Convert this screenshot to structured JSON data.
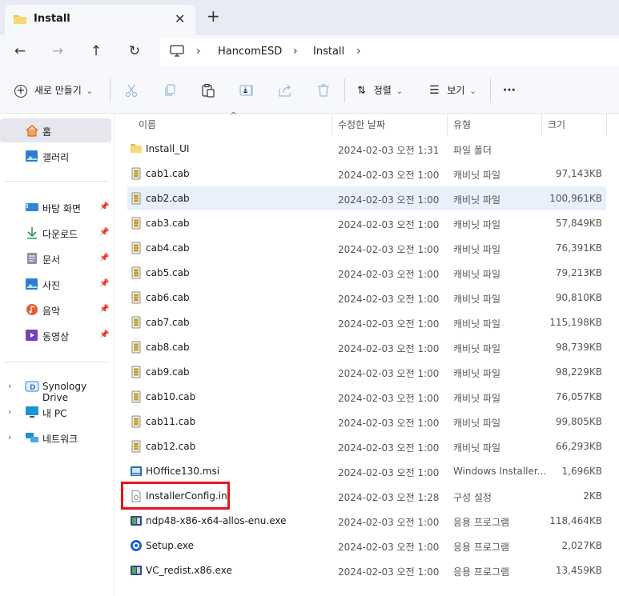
{
  "window": {
    "tab_title": "Install",
    "tab_close": "✕",
    "new_tab": "+"
  },
  "nav": {
    "back": "←",
    "forward": "→",
    "up": "↑",
    "refresh": "↻"
  },
  "breadcrumb": {
    "sep": "›",
    "items": [
      "HancomESD",
      "Install"
    ]
  },
  "toolbar": {
    "new_label": "새로 만들기",
    "sort_label": "정렬",
    "view_label": "보기",
    "more_label": "···",
    "dropdown": "⌄"
  },
  "sidebar": {
    "home": "홈",
    "gallery": "갤러리",
    "pinned": [
      {
        "label": "바탕 화면",
        "icon": "desktop-icon"
      },
      {
        "label": "다운로드",
        "icon": "download-icon"
      },
      {
        "label": "문서",
        "icon": "document-icon"
      },
      {
        "label": "사진",
        "icon": "pictures-icon"
      },
      {
        "label": "음악",
        "icon": "music-icon"
      },
      {
        "label": "동영상",
        "icon": "video-icon"
      }
    ],
    "pin_glyph": "📌",
    "tree": [
      {
        "label": "Synology Drive",
        "icon": "synology-drive-icon"
      },
      {
        "label": "내 PC",
        "icon": "this-pc-icon"
      },
      {
        "label": "네트워크",
        "icon": "network-icon"
      }
    ],
    "chevron": "›"
  },
  "columns": {
    "name": "이름",
    "date": "수정한 날짜",
    "type": "유형",
    "size": "크기",
    "sort_arrow": "^"
  },
  "files": [
    {
      "name": "Install_UI",
      "date": "2024-02-03 오전 1:31",
      "type": "파일 폴더",
      "size": "",
      "icon": "folder"
    },
    {
      "name": "cab1.cab",
      "date": "2024-02-03 오전 1:00",
      "type": "캐비닛 파일",
      "size": "97,143KB",
      "icon": "cab"
    },
    {
      "name": "cab2.cab",
      "date": "2024-02-03 오전 1:00",
      "type": "캐비닛 파일",
      "size": "100,961KB",
      "icon": "cab"
    },
    {
      "name": "cab3.cab",
      "date": "2024-02-03 오전 1:00",
      "type": "캐비닛 파일",
      "size": "57,849KB",
      "icon": "cab"
    },
    {
      "name": "cab4.cab",
      "date": "2024-02-03 오전 1:00",
      "type": "캐비닛 파일",
      "size": "76,391KB",
      "icon": "cab"
    },
    {
      "name": "cab5.cab",
      "date": "2024-02-03 오전 1:00",
      "type": "캐비닛 파일",
      "size": "79,213KB",
      "icon": "cab"
    },
    {
      "name": "cab6.cab",
      "date": "2024-02-03 오전 1:00",
      "type": "캐비닛 파일",
      "size": "90,810KB",
      "icon": "cab"
    },
    {
      "name": "cab7.cab",
      "date": "2024-02-03 오전 1:00",
      "type": "캐비닛 파일",
      "size": "115,198KB",
      "icon": "cab"
    },
    {
      "name": "cab8.cab",
      "date": "2024-02-03 오전 1:00",
      "type": "캐비닛 파일",
      "size": "98,739KB",
      "icon": "cab"
    },
    {
      "name": "cab9.cab",
      "date": "2024-02-03 오전 1:00",
      "type": "캐비닛 파일",
      "size": "98,229KB",
      "icon": "cab"
    },
    {
      "name": "cab10.cab",
      "date": "2024-02-03 오전 1:00",
      "type": "캐비닛 파일",
      "size": "76,057KB",
      "icon": "cab"
    },
    {
      "name": "cab11.cab",
      "date": "2024-02-03 오전 1:00",
      "type": "캐비닛 파일",
      "size": "99,805KB",
      "icon": "cab"
    },
    {
      "name": "cab12.cab",
      "date": "2024-02-03 오전 1:00",
      "type": "캐비닛 파일",
      "size": "66,293KB",
      "icon": "cab"
    },
    {
      "name": "HOffice130.msi",
      "date": "2024-02-03 오전 1:00",
      "type": "Windows Installer...",
      "size": "1,696KB",
      "icon": "msi"
    },
    {
      "name": "InstallerConfig.ini",
      "date": "2024-02-03 오전 1:28",
      "type": "구성 설정",
      "size": "2KB",
      "icon": "ini"
    },
    {
      "name": "ndp48-x86-x64-allos-enu.exe",
      "date": "2024-02-03 오전 1:00",
      "type": "응용 프로그램",
      "size": "118,464KB",
      "icon": "exe"
    },
    {
      "name": "Setup.exe",
      "date": "2024-02-03 오전 1:00",
      "type": "응용 프로그램",
      "size": "2,027KB",
      "icon": "setup"
    },
    {
      "name": "VC_redist.x86.exe",
      "date": "2024-02-03 오전 1:00",
      "type": "응용 프로그램",
      "size": "13,459KB",
      "icon": "exe"
    }
  ],
  "selected_file": "cab2.cab",
  "highlighted_file": "InstallerConfig.ini",
  "colors": {
    "highlight_box": "#e8141a",
    "selection": "#e8f0fb",
    "folder": "#f2c14e",
    "accent": "#0067c0"
  }
}
